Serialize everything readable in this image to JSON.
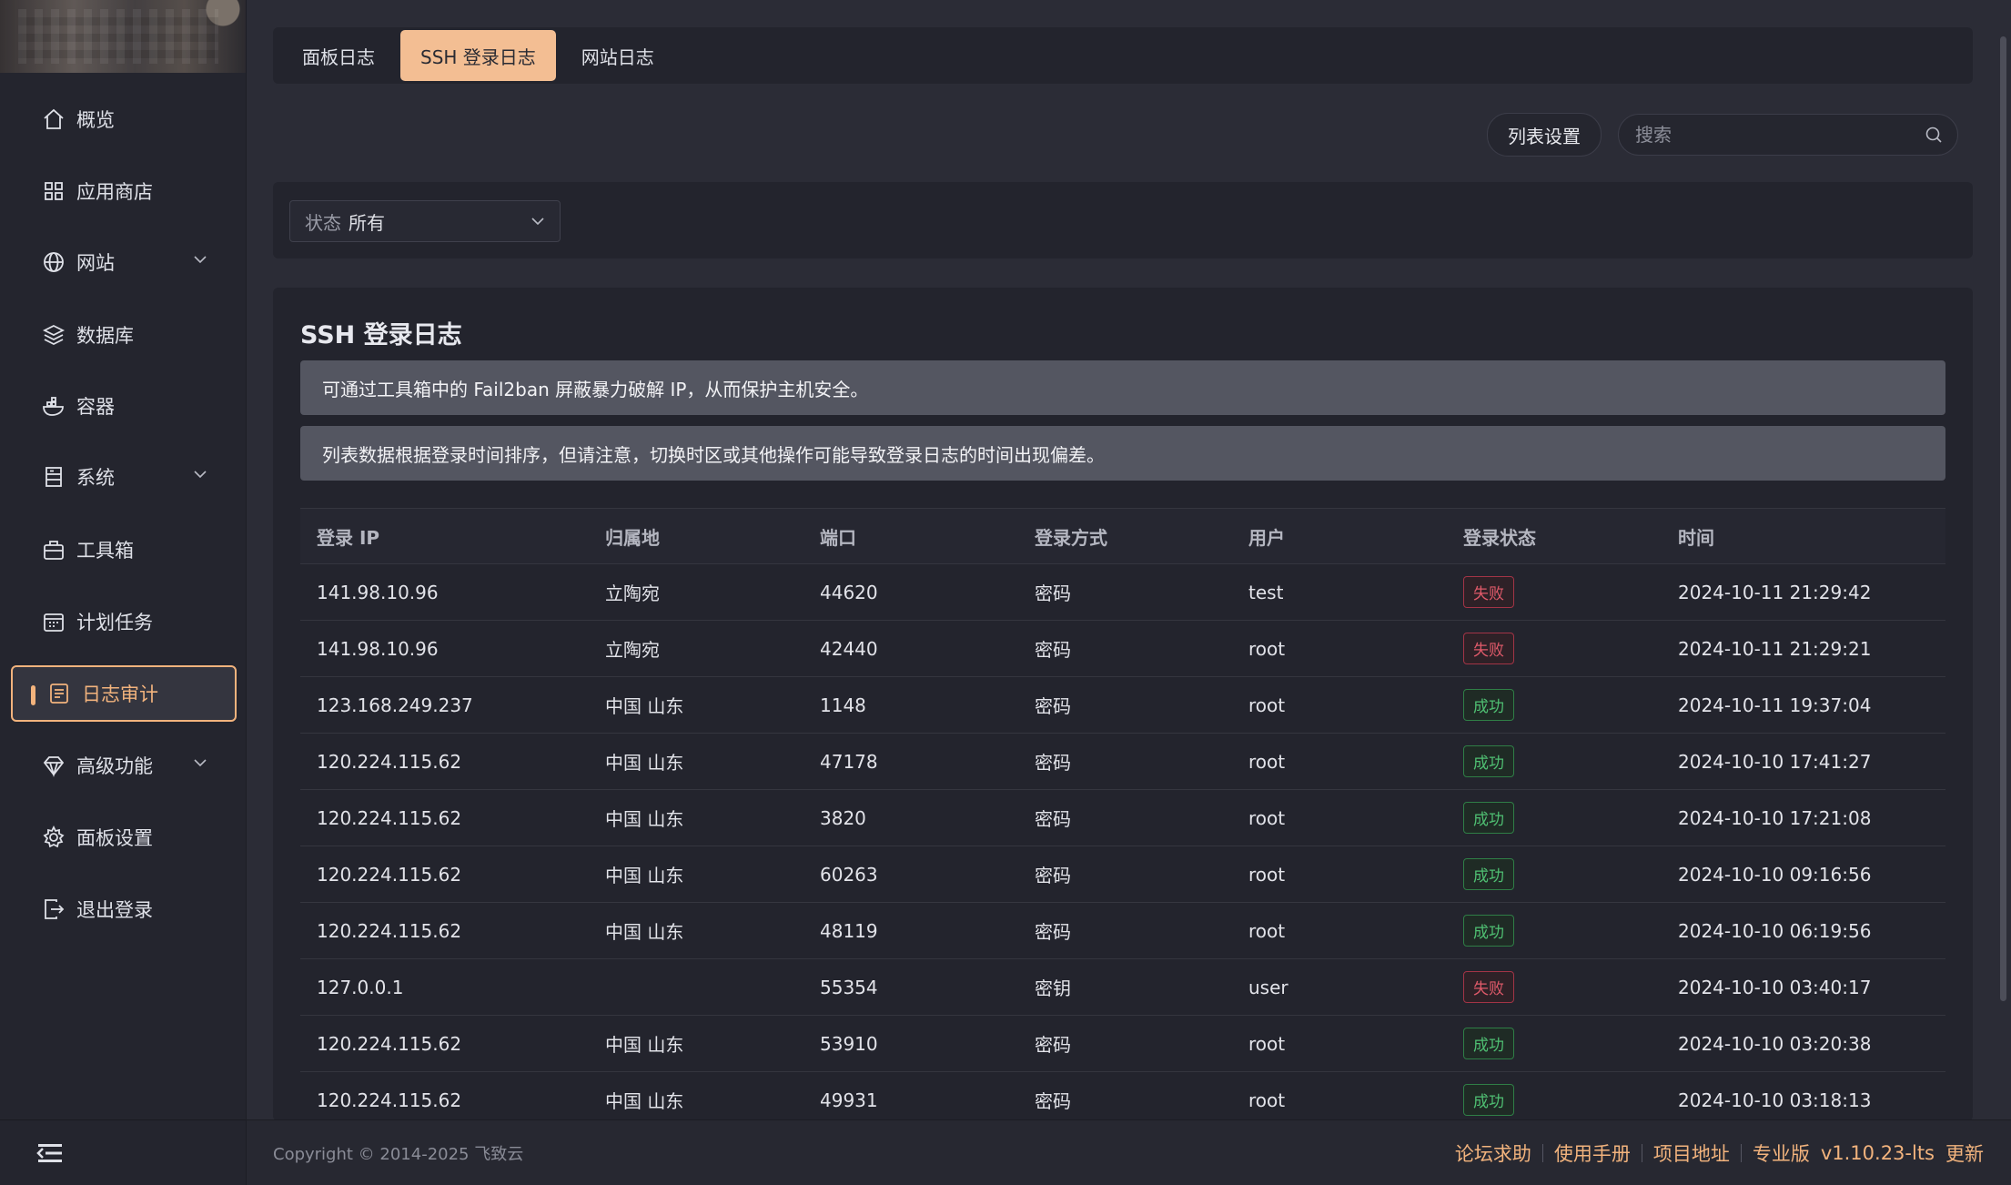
{
  "sidebar": {
    "items": [
      {
        "label": "概览",
        "icon": "home-icon"
      },
      {
        "label": "应用商店",
        "icon": "grid-icon"
      },
      {
        "label": "网站",
        "icon": "globe-icon",
        "expandable": true
      },
      {
        "label": "数据库",
        "icon": "layers-icon"
      },
      {
        "label": "容器",
        "icon": "docker-icon"
      },
      {
        "label": "系统",
        "icon": "server-icon",
        "expandable": true
      },
      {
        "label": "工具箱",
        "icon": "toolbox-icon"
      },
      {
        "label": "计划任务",
        "icon": "calendar-icon"
      },
      {
        "label": "日志审计",
        "icon": "log-icon",
        "active": true
      },
      {
        "label": "高级功能",
        "icon": "diamond-icon",
        "expandable": true
      },
      {
        "label": "面板设置",
        "icon": "gear-icon"
      },
      {
        "label": "退出登录",
        "icon": "logout-icon"
      }
    ]
  },
  "tabs": [
    {
      "label": "面板日志"
    },
    {
      "label": "SSH 登录日志",
      "active": true
    },
    {
      "label": "网站日志"
    }
  ],
  "toolbar": {
    "settings_label": "列表设置",
    "search_placeholder": "搜索"
  },
  "filter": {
    "label": "状态",
    "value": "所有"
  },
  "card": {
    "title": "SSH 登录日志",
    "notices": [
      "可通过工具箱中的 Fail2ban 屏蔽暴力破解 IP，从而保护主机安全。",
      "列表数据根据登录时间排序，但请注意，切换时区或其他操作可能导致登录日志的时间出现偏差。"
    ]
  },
  "table": {
    "headers": [
      "登录 IP",
      "归属地",
      "端口",
      "登录方式",
      "用户",
      "登录状态",
      "时间"
    ],
    "rows": [
      {
        "ip": "141.98.10.96",
        "loc": "立陶宛",
        "port": "44620",
        "method": "密码",
        "user": "test",
        "status": "失败",
        "time": "2024-10-11 21:29:42"
      },
      {
        "ip": "141.98.10.96",
        "loc": "立陶宛",
        "port": "42440",
        "method": "密码",
        "user": "root",
        "status": "失败",
        "time": "2024-10-11 21:29:21"
      },
      {
        "ip": "123.168.249.237",
        "loc": "中国 山东",
        "port": "1148",
        "method": "密码",
        "user": "root",
        "status": "成功",
        "time": "2024-10-11 19:37:04"
      },
      {
        "ip": "120.224.115.62",
        "loc": "中国 山东",
        "port": "47178",
        "method": "密码",
        "user": "root",
        "status": "成功",
        "time": "2024-10-10 17:41:27"
      },
      {
        "ip": "120.224.115.62",
        "loc": "中国 山东",
        "port": "3820",
        "method": "密码",
        "user": "root",
        "status": "成功",
        "time": "2024-10-10 17:21:08"
      },
      {
        "ip": "120.224.115.62",
        "loc": "中国 山东",
        "port": "60263",
        "method": "密码",
        "user": "root",
        "status": "成功",
        "time": "2024-10-10 09:16:56"
      },
      {
        "ip": "120.224.115.62",
        "loc": "中国 山东",
        "port": "48119",
        "method": "密码",
        "user": "root",
        "status": "成功",
        "time": "2024-10-10 06:19:56"
      },
      {
        "ip": "127.0.0.1",
        "loc": "",
        "port": "55354",
        "method": "密钥",
        "user": "user",
        "status": "失败",
        "time": "2024-10-10 03:40:17"
      },
      {
        "ip": "120.224.115.62",
        "loc": "中国 山东",
        "port": "53910",
        "method": "密码",
        "user": "root",
        "status": "成功",
        "time": "2024-10-10 03:20:38"
      },
      {
        "ip": "120.224.115.62",
        "loc": "中国 山东",
        "port": "49931",
        "method": "密码",
        "user": "root",
        "status": "成功",
        "time": "2024-10-10 03:18:13"
      }
    ]
  },
  "footer": {
    "copyright": "Copyright © 2014-2025 飞致云",
    "links": [
      "论坛求助",
      "使用手册",
      "项目地址"
    ],
    "edition": "专业版",
    "version": "v1.10.23-lts",
    "update": "更新"
  },
  "colors": {
    "accent": "#f2b37d",
    "fail": "#e05a6a",
    "success": "#4fbf72",
    "background": "#2b2c36"
  }
}
